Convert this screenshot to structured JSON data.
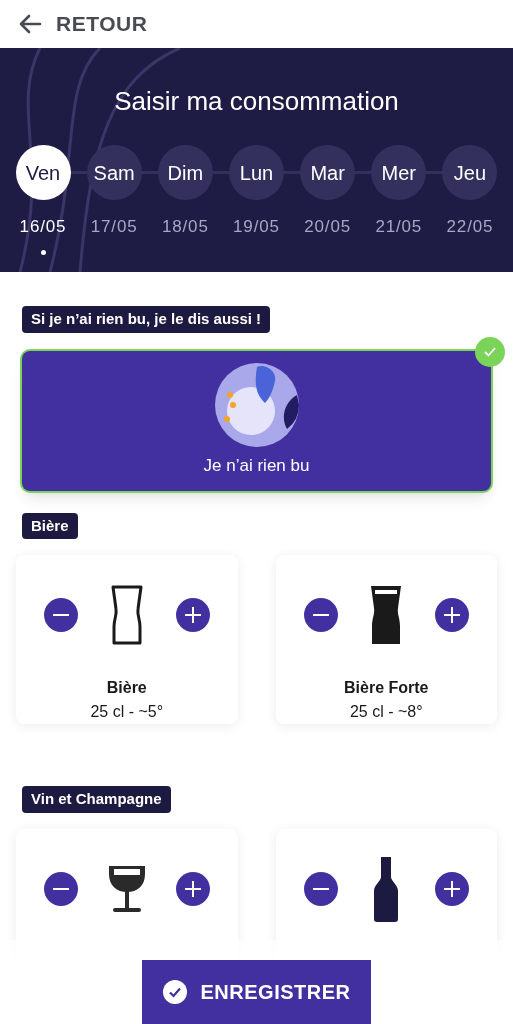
{
  "back": {
    "label": "RETOUR"
  },
  "banner": {
    "title": "Saisir ma consommation",
    "days": [
      {
        "day": "Ven",
        "date": "16/05",
        "selected": true
      },
      {
        "day": "Sam",
        "date": "17/05",
        "selected": false
      },
      {
        "day": "Dim",
        "date": "18/05",
        "selected": false
      },
      {
        "day": "Lun",
        "date": "19/05",
        "selected": false
      },
      {
        "day": "Mar",
        "date": "20/05",
        "selected": false
      },
      {
        "day": "Mer",
        "date": "21/05",
        "selected": false
      },
      {
        "day": "Jeu",
        "date": "22/05",
        "selected": false
      }
    ]
  },
  "nothing": {
    "heading": "Si je n’ai rien bu, je le dis aussi !",
    "label": "Je n’ai rien bu",
    "checked": true
  },
  "sections": [
    {
      "heading": "Bière",
      "drinks": [
        {
          "kind": "pint",
          "name": "Bière",
          "spec": "25 cl - ~5°"
        },
        {
          "kind": "strong-pint",
          "name": "Bière Forte",
          "spec": "25 cl - ~8°"
        }
      ]
    },
    {
      "heading": "Vin et Champagne",
      "drinks": [
        {
          "kind": "wine-glass"
        },
        {
          "kind": "bottle"
        }
      ]
    }
  ],
  "save_button": {
    "label": "ENREGISTRER"
  }
}
